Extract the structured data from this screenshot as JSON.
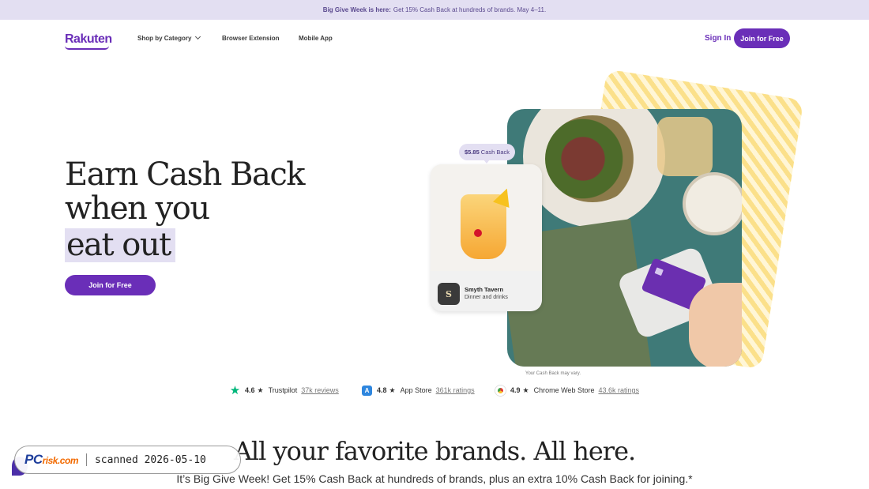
{
  "banner": {
    "bold": "Big Give Week is here:",
    "text": "Get 15% Cash Back at hundreds of brands. May 4–11."
  },
  "nav": {
    "logo": "Rakuten",
    "links": [
      {
        "label": "Shop by Category"
      },
      {
        "label": "Browser Extension"
      },
      {
        "label": "Mobile App"
      }
    ],
    "sign_in": "Sign In",
    "join": "Join for Free"
  },
  "hero": {
    "line1": "Earn Cash Back",
    "line2": "when you",
    "highlight": "eat out",
    "cta": "Join for Free",
    "cashback_amount": "$5.85",
    "cashback_label": "Cash Back",
    "merchant_name": "Smyth Tavern",
    "merchant_category": "Dinner and drinks",
    "merchant_logo_text": "S",
    "disclaimer": "Your Cash Back may vary."
  },
  "ratings": [
    {
      "score": "4.6",
      "source": "Trustpilot",
      "count": "37k reviews",
      "icon": "trustpilot-star-icon"
    },
    {
      "score": "4.8",
      "source": "App Store",
      "count": "361k ratings",
      "icon": "app-store-icon"
    },
    {
      "score": "4.9",
      "source": "Chrome Web Store",
      "count": "43.6k ratings",
      "icon": "chrome-web-store-icon"
    }
  ],
  "section": {
    "title": "All your favorite brands. All here.",
    "subtitle": "It’s Big Give Week! Get 15% Cash Back at hundreds of brands, plus an extra 10% Cash Back for joining.*"
  },
  "watermark": {
    "logo_main": "PC",
    "logo_rest": "risk.com",
    "scanned": "scanned 2026-05-10"
  },
  "colors": {
    "brand": "#6a2eb8",
    "banner_bg": "#e3dff2",
    "accent_yellow": "#fbe08a"
  }
}
